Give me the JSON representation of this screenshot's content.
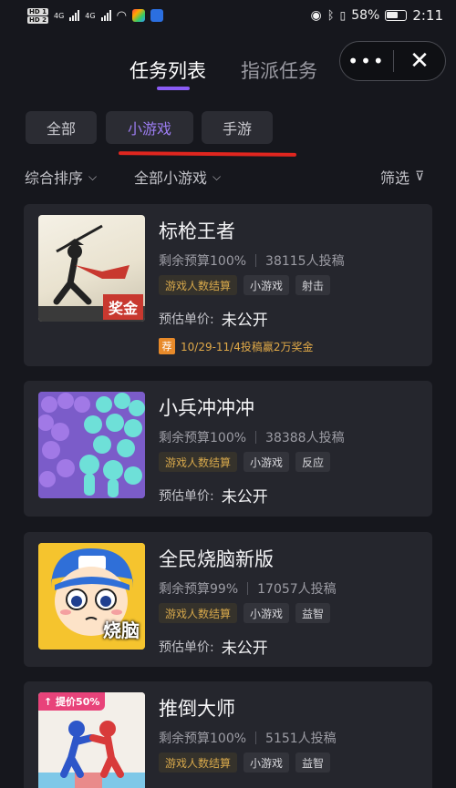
{
  "status_bar": {
    "hd1": "HD 1",
    "hd2": "HD 2",
    "net1": "4G",
    "net2": "4G",
    "battery_pct": "58%",
    "time": "2:11"
  },
  "header": {
    "tabs": [
      {
        "label": "任务列表",
        "active": true
      },
      {
        "label": "指派任务",
        "active": false
      }
    ],
    "more_label": "•••",
    "close_label": "✕"
  },
  "categories": [
    {
      "label": "全部",
      "active": false
    },
    {
      "label": "小游戏",
      "active": true
    },
    {
      "label": "手游",
      "active": false
    }
  ],
  "filters": {
    "sort_label": "综合排序",
    "scope_label": "全部小游戏",
    "filter_label": "筛选"
  },
  "cards": [
    {
      "title": "标枪王者",
      "budget": "剩余预算100%",
      "submissions": "38115人投稿",
      "tags": [
        "游戏人数结算",
        "小游戏",
        "射击"
      ],
      "price_label": "预估单价:",
      "price_value": "未公开",
      "promo_badge": "荐",
      "promo_text": "10/29-11/4投稿赢2万奖金",
      "thumb_badge": "奖金"
    },
    {
      "title": "小兵冲冲冲",
      "budget": "剩余预算100%",
      "submissions": "38388人投稿",
      "tags": [
        "游戏人数结算",
        "小游戏",
        "反应"
      ],
      "price_label": "预估单价:",
      "price_value": "未公开"
    },
    {
      "title": "全民烧脑新版",
      "budget": "剩余预算99%",
      "submissions": "17057人投稿",
      "tags": [
        "游戏人数结算",
        "小游戏",
        "益智"
      ],
      "price_label": "预估单价:",
      "price_value": "未公开",
      "thumb_badge": "烧脑"
    },
    {
      "title": "推倒大师",
      "budget": "剩余预算100%",
      "submissions": "5151人投稿",
      "tags": [
        "游戏人数结算",
        "小游戏",
        "益智"
      ],
      "thumb_badge": "↑ 提价50%"
    }
  ],
  "colors": {
    "background": "#16171d",
    "card": "#25262d",
    "accent": "#8b5cf6",
    "tag_gold": "#d7a84b",
    "annotation_red": "#e0261f"
  }
}
